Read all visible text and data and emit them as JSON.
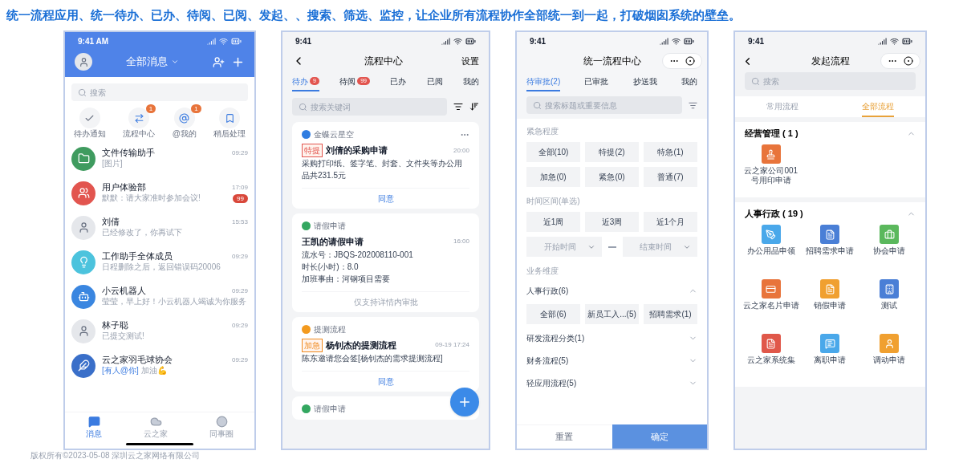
{
  "headline": "统一流程应用、统一待办、已办、待阅、已阅、发起、、搜索、筛选、监控，让企业所有流程协作全部统一到一起，打破烟囱系统的壁垒。",
  "footer": "版权所有©2023-05-08 深圳云之家网络有限公司",
  "messages_screen": {
    "status_time": "9:41 AM",
    "title": "全部消息",
    "search_placeholder": "搜索",
    "shortcuts": [
      {
        "kind": "check",
        "label": "待办通知"
      },
      {
        "kind": "flow",
        "label": "流程中心",
        "badge": "1"
      },
      {
        "kind": "at",
        "label": "@我的",
        "badge": "1"
      },
      {
        "kind": "bookmark",
        "label": "稍后处理"
      }
    ],
    "chats": [
      {
        "kind": "folder",
        "name": "文件传输助手",
        "preview": "[图片]",
        "time": "09:29"
      },
      {
        "kind": "group",
        "name": "用户体验部",
        "preview": "默默：请大家准时参加会议!",
        "time": "17:09",
        "unread": "99"
      },
      {
        "kind": "person",
        "name": "刘倩",
        "preview": "已经修改了，你再试下",
        "time": "15:53"
      },
      {
        "kind": "bulb",
        "name": "工作助手全体成员",
        "preview": "日程删除之后，返回错误码20006",
        "time": "09:29"
      },
      {
        "kind": "robot",
        "name": "小云机器人",
        "preview": "莹莹，早上好！小云机器人竭诚为你服务",
        "time": "09:29"
      },
      {
        "kind": "person",
        "name": "林子聪",
        "preview": "已提交测试!",
        "time": "09:29"
      },
      {
        "kind": "badminton",
        "name": "云之家羽毛球协会",
        "mention": "[有人@你]",
        "preview": "加油💪",
        "time": "09:29"
      }
    ],
    "tabs": [
      {
        "kind": "chat",
        "label": "消息",
        "selected": true
      },
      {
        "kind": "cloud",
        "label": "云之家",
        "selected": false
      },
      {
        "kind": "ring",
        "label": "同事圈",
        "selected": false
      }
    ]
  },
  "process_center_screen": {
    "status_time": "9:41",
    "title": "流程中心",
    "action": "设置",
    "search_placeholder": "搜索关键词",
    "tabs": [
      {
        "label": "待办",
        "badge": "9",
        "selected": true
      },
      {
        "label": "待阅",
        "badge": "99",
        "selected": false
      },
      {
        "label": "已办",
        "selected": false
      },
      {
        "label": "已阅",
        "selected": false
      },
      {
        "label": "我的",
        "selected": false
      }
    ],
    "cards": [
      {
        "source": "金蝶云星空",
        "color": "#2f7de1",
        "tag": {
          "label": "特提",
          "color": "#e2554f"
        },
        "title": "刘倩的采购申请",
        "time": "20:00",
        "lines": [
          "采购打印纸、签字笔、封套、文件夹等办公用品共231.5元"
        ],
        "action": "同意",
        "action_enabled": true,
        "more": true
      },
      {
        "source": "请假申请",
        "color": "#33a760",
        "title": "王凯的请假申请",
        "time": "16:00",
        "lines": [
          "流水号：JBQS-202008110-001",
          "时长(小时)：8.0",
          "加班事由：河钢项目需要"
        ],
        "action": "仅支持详情内审批",
        "action_enabled": false
      },
      {
        "source": "提测流程",
        "color": "#f39a1e",
        "tag": {
          "label": "加急",
          "color": "#f08a1e"
        },
        "title": "杨钊杰的提测流程",
        "time": "09-19 17:24",
        "lines": [
          "陈东邀请您会签[杨钊杰的需求提测流程]"
        ],
        "action": "同意",
        "action_enabled": true
      },
      {
        "source": "请假申请",
        "color": "#33a760"
      }
    ]
  },
  "filter_screen": {
    "status_time": "9:41",
    "title": "统一流程中心",
    "search_placeholder": "搜索标题或重要信息",
    "tabs": [
      {
        "label": "待审批(2)",
        "selected": true
      },
      {
        "label": "已审批",
        "selected": false
      },
      {
        "label": "抄送我",
        "selected": false
      },
      {
        "label": "我的",
        "selected": false
      }
    ],
    "urgency_label": "紧急程度",
    "urgency_options": [
      "全部(10)",
      "特提(2)",
      "特急(1)",
      "加急(0)",
      "紧急(0)",
      "普通(7)"
    ],
    "time_label": "时间区间(单选)",
    "time_options": [
      "近1周",
      "近3周",
      "近1个月"
    ],
    "start_placeholder": "开始时间",
    "end_placeholder": "结束时间",
    "business_label": "业务维度",
    "groups": [
      {
        "name": "人事行政(6)",
        "expanded": true,
        "options": [
          "全部(6)",
          "新员工入...(5)",
          "招聘需求(1)"
        ]
      },
      {
        "name": "研发流程分类(1)",
        "expanded": false
      },
      {
        "name": "财务流程(5)",
        "expanded": false
      },
      {
        "name": "轻应用流程(5)",
        "expanded": false
      }
    ],
    "reset": "重置",
    "confirm": "确定"
  },
  "launch_screen": {
    "status_time": "9:41",
    "title": "发起流程",
    "search_placeholder": "搜索",
    "tabs": [
      {
        "label": "常用流程",
        "selected": false
      },
      {
        "label": "全部流程",
        "selected": true
      }
    ],
    "categories": [
      {
        "name": "经营管理 ( 1 )",
        "expanded": true,
        "items": [
          {
            "kind": "stamp",
            "color": "#e8743b",
            "label": "云之家公司001号用印申请"
          }
        ]
      },
      {
        "name": "人事行政 ( 19 )",
        "expanded": true,
        "items": [
          {
            "kind": "tools",
            "color": "#4aa8ea",
            "label": "办公用品申领"
          },
          {
            "kind": "doc",
            "color": "#4a7fd6",
            "label": "招聘需求申请"
          },
          {
            "kind": "briefcase",
            "color": "#5bb85d",
            "label": "协会申请"
          },
          {
            "kind": "card",
            "color": "#e8743b",
            "label": "云之家名片申请"
          },
          {
            "kind": "doc",
            "color": "#f0a030",
            "label": "销假申请"
          },
          {
            "kind": "building",
            "color": "#4a7fd6",
            "label": "测试"
          },
          {
            "kind": "doc",
            "color": "#e0584a",
            "label": "云之家系统集"
          },
          {
            "kind": "chat",
            "color": "#4aa8ea",
            "label": "离职申请"
          },
          {
            "kind": "person",
            "color": "#f0a030",
            "label": "调动申请"
          }
        ]
      }
    ]
  }
}
